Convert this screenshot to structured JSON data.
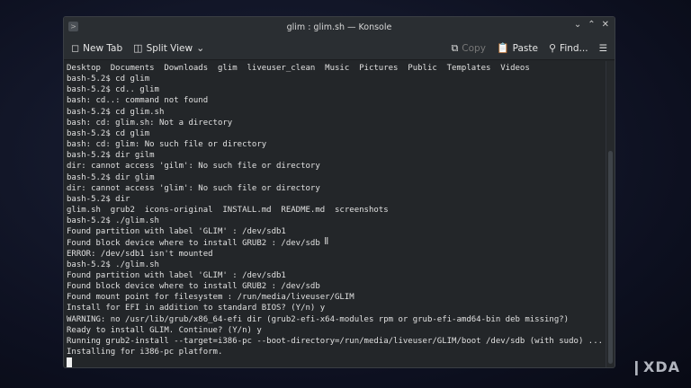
{
  "window": {
    "title": "glim : glim.sh — Konsole"
  },
  "toolbar": {
    "new_tab": "New Tab",
    "split_view": "Split View",
    "copy": "Copy",
    "paste": "Paste",
    "find": "Find..."
  },
  "terminal": {
    "lines": [
      "Desktop  Documents  Downloads  glim  liveuser_clean  Music  Pictures  Public  Templates  Videos",
      "bash-5.2$ cd glim",
      "bash-5.2$ cd.. glim",
      "bash: cd..: command not found",
      "bash-5.2$ cd glim.sh",
      "bash: cd: glim.sh: Not a directory",
      "bash-5.2$ cd glim",
      "bash: cd: glim: No such file or directory",
      "bash-5.2$ dir gilm",
      "dir: cannot access 'gilm': No such file or directory",
      "bash-5.2$ dir glim",
      "dir: cannot access 'glim': No such file or directory",
      "bash-5.2$ dir",
      "glim.sh  grub2  icons-original  INSTALL.md  README.md  screenshots",
      "bash-5.2$ ./glim.sh",
      "Found partition with label 'GLIM' : /dev/sdb1",
      "Found block device where to install GRUB2 : /dev/sdb",
      "ERROR: /dev/sdb1 isn't mounted",
      "bash-5.2$ ./glim.sh",
      "Found partition with label 'GLIM' : /dev/sdb1",
      "Found block device where to install GRUB2 : /dev/sdb",
      "Found mount point for filesystem : /run/media/liveuser/GLIM",
      "Install for EFI in addition to standard BIOS? (Y/n) y",
      "WARNING: no /usr/lib/grub/x86_64-efi dir (grub2-efi-x64-modules rpm or grub-efi-amd64-bin deb missing?)",
      "Ready to install GLIM. Continue? (Y/n) y",
      "Running grub2-install --target=i386-pc --boot-directory=/run/media/liveuser/GLIM/boot /dev/sdb (with sudo) ...",
      "Installing for i386-pc platform."
    ]
  },
  "watermark": "XDA"
}
